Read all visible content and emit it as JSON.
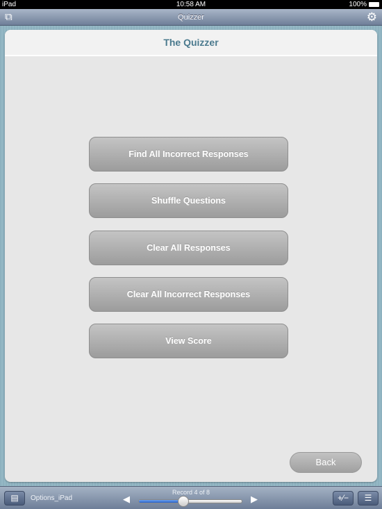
{
  "status_bar": {
    "device": "iPad",
    "time": "10:58 AM",
    "battery": "100%"
  },
  "nav": {
    "title": "Quizzer",
    "left_icon": "windows-icon",
    "right_icon": "gear-icon"
  },
  "card": {
    "title": "The Quizzer",
    "buttons": [
      {
        "label": "Find All Incorrect Responses"
      },
      {
        "label": "Shuffle Questions"
      },
      {
        "label": "Clear All Responses"
      },
      {
        "label": "Clear All Incorrect Responses"
      },
      {
        "label": "View Score"
      }
    ],
    "back_label": "Back"
  },
  "toolbar": {
    "layout_name": "Options_iPad",
    "record_text": "Record 4 of 8",
    "record_current": 4,
    "record_total": 8,
    "slider_progress": 0.43
  },
  "colors": {
    "accent": "#4b7a8e",
    "slider_fill": "#2a62c9"
  }
}
